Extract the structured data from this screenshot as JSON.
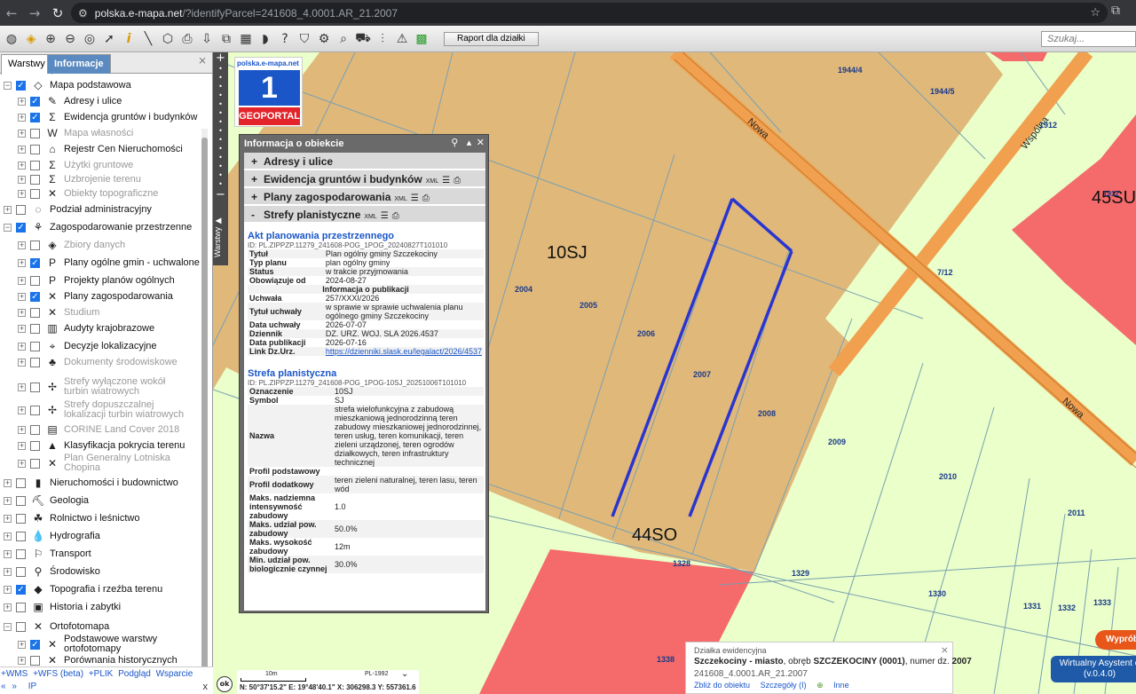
{
  "browser": {
    "url_host": "polska.e-mapa.net",
    "url_query": "/?identifyParcel=241608_4.0001.AR_21.2007"
  },
  "toolbar": {
    "icons": [
      "globe-icon",
      "layers-icon",
      "zoom-in-icon",
      "zoom-out-icon",
      "full-extent-icon",
      "pointer-icon",
      "info-icon",
      "measure-line-icon",
      "measure-area-icon",
      "print-icon",
      "download-icon",
      "share-icon",
      "grid-icon",
      "comment-icon",
      "help-icon",
      "shield-icon",
      "tools-icon",
      "search-icon",
      "cart-icon",
      "filter-icon",
      "warning-icon",
      "color-icon"
    ],
    "raport_label": "Raport dla działki",
    "search_placeholder": "Szukaj..."
  },
  "left_panel": {
    "tabs": [
      "Warstwy",
      "Informacje"
    ],
    "layers": [
      {
        "name": "Mapa podstawowa",
        "checked": true,
        "level": 0,
        "expander": "−",
        "dim": false
      },
      {
        "name": "Adresy i ulice",
        "checked": true,
        "level": 1,
        "expander": "+",
        "dim": false
      },
      {
        "name": "Ewidencja gruntów i budynków",
        "checked": true,
        "level": 1,
        "expander": "+",
        "dim": false
      },
      {
        "name": "Mapa własności",
        "checked": false,
        "level": 1,
        "expander": "+",
        "dim": true
      },
      {
        "name": "Rejestr Cen Nieruchomości",
        "checked": false,
        "level": 1,
        "expander": "+",
        "dim": false
      },
      {
        "name": "Użytki gruntowe",
        "checked": false,
        "level": 1,
        "expander": "+",
        "dim": true
      },
      {
        "name": "Uzbrojenie terenu",
        "checked": false,
        "level": 1,
        "expander": "+",
        "dim": true
      },
      {
        "name": "Obiekty topograficzne",
        "checked": false,
        "level": 1,
        "expander": "+",
        "dim": true
      },
      {
        "name": "Podział administracyjny",
        "checked": false,
        "level": 0,
        "expander": "+",
        "dim": false
      },
      {
        "name": "Zagospodarowanie przestrzenne",
        "checked": true,
        "level": 0,
        "expander": "−",
        "dim": false
      },
      {
        "name": "Zbiory danych",
        "checked": false,
        "level": 1,
        "expander": "+",
        "dim": true
      },
      {
        "name": "Plany ogólne gmin - uchwalone",
        "checked": true,
        "level": 1,
        "expander": "+",
        "dim": false
      },
      {
        "name": "Projekty planów ogólnych",
        "checked": false,
        "level": 1,
        "expander": "+",
        "dim": false
      },
      {
        "name": "Plany zagospodarowania",
        "checked": true,
        "level": 1,
        "expander": "+",
        "dim": false
      },
      {
        "name": "Studium",
        "checked": false,
        "level": 1,
        "expander": "+",
        "dim": true
      },
      {
        "name": "Audyty krajobrazowe",
        "checked": false,
        "level": 1,
        "expander": "+",
        "dim": false
      },
      {
        "name": "Decyzje lokalizacyjne",
        "checked": false,
        "level": 1,
        "expander": "+",
        "dim": false
      },
      {
        "name": "Dokumenty środowiskowe",
        "checked": false,
        "level": 1,
        "expander": "+",
        "dim": true
      },
      {
        "name": "Strefy wyłączone wokół turbin wiatrowych",
        "checked": false,
        "level": 1,
        "expander": "+",
        "dim": true
      },
      {
        "name": "Strefy dopuszczalnej lokalizacji turbin wiatrowych",
        "checked": false,
        "level": 1,
        "expander": "+",
        "dim": true
      },
      {
        "name": "CORINE Land Cover 2018",
        "checked": false,
        "level": 1,
        "expander": "+",
        "dim": true
      },
      {
        "name": "Klasyfikacja pokrycia terenu",
        "checked": false,
        "level": 1,
        "expander": "+",
        "dim": false
      },
      {
        "name": "Plan Generalny Lotniska Chopina",
        "checked": false,
        "level": 1,
        "expander": "+",
        "dim": true
      },
      {
        "name": "Nieruchomości i budownictwo",
        "checked": false,
        "level": 0,
        "expander": "+",
        "dim": false
      },
      {
        "name": "Geologia",
        "checked": false,
        "level": 0,
        "expander": "+",
        "dim": false
      },
      {
        "name": "Rolnictwo i leśnictwo",
        "checked": false,
        "level": 0,
        "expander": "+",
        "dim": false
      },
      {
        "name": "Hydrografia",
        "checked": false,
        "level": 0,
        "expander": "+",
        "dim": false
      },
      {
        "name": "Transport",
        "checked": false,
        "level": 0,
        "expander": "+",
        "dim": false
      },
      {
        "name": "Środowisko",
        "checked": false,
        "level": 0,
        "expander": "+",
        "dim": false
      },
      {
        "name": "Topografia i rzeźba terenu",
        "checked": true,
        "level": 0,
        "expander": "+",
        "dim": false
      },
      {
        "name": "Historia i zabytki",
        "checked": false,
        "level": 0,
        "expander": "+",
        "dim": false
      },
      {
        "name": "Ortofotomapa",
        "checked": false,
        "level": 0,
        "expander": "−",
        "dim": false
      },
      {
        "name": "Podstawowe warstwy ortofotomapy",
        "checked": true,
        "level": 1,
        "expander": "+",
        "dim": false
      },
      {
        "name": "Porównania historycznych",
        "checked": false,
        "level": 1,
        "expander": "+",
        "dim": false
      }
    ],
    "footer_links": [
      "+WMS",
      "+WFS (beta)",
      "+PLIK",
      "Podgląd",
      "Wsparcie"
    ],
    "footer_row2": [
      "«",
      "»",
      "IP"
    ],
    "vertical_tab": "Warstwy"
  },
  "logo": {
    "site": "polska.e-mapa.net",
    "number": "1",
    "label": "GEOPORTAL"
  },
  "info_popup": {
    "title": "Informacja o obiekcie",
    "sections": [
      {
        "sign": "+",
        "label": "Adresy i ulice",
        "tools": false
      },
      {
        "sign": "+",
        "label": "Ewidencja gruntów i budynków",
        "tools": true
      },
      {
        "sign": "+",
        "label": "Plany zagospodarowania",
        "tools": true
      },
      {
        "sign": "-",
        "label": "Strefy planistyczne",
        "tools": true
      }
    ],
    "xml_label": "XML",
    "act": {
      "heading": "Akt planowania przestrzennego",
      "id": "ID: PL.ZIPPZP.11279_241608-POG_1POG_20240827T101010",
      "rows": [
        [
          "Tytuł",
          "Plan ogólny gminy Szczekociny"
        ],
        [
          "Typ planu",
          "plan ogólny gminy"
        ],
        [
          "Status",
          "w trakcie przyjmowania"
        ],
        [
          "Obowiązuje od",
          "2024-08-27"
        ]
      ],
      "pub_header": "Informacja o publikacji",
      "pub_rows": [
        [
          "Uchwała",
          "257/XXXI/2026"
        ],
        [
          "Tytuł uchwały",
          "w sprawie w sprawie uchwalenia planu ogólnego gminy Szczekociny"
        ],
        [
          "Data uchwały",
          "2026-07-07"
        ],
        [
          "Dziennik",
          "DZ. URZ. WOJ. SLA 2026.4537"
        ],
        [
          "Data publikacji",
          "2026-07-16"
        ]
      ],
      "link_key": "Link Dz.Urz.",
      "link_value": "https://dzienniki.slask.eu/legalact/2026/4537"
    },
    "zone": {
      "heading": "Strefa planistyczna",
      "id": "ID: PL.ZIPPZP.11279_241608-POG_1POG-10SJ_20251006T101010",
      "rows": [
        [
          "Oznaczenie",
          "10SJ"
        ],
        [
          "Symbol",
          "SJ"
        ],
        [
          "Nazwa",
          "strefa wielofunkcyjna z zabudową mieszkaniową jednorodzinną teren zabudowy mieszkaniowej jednorodzinnej, teren usług, teren komunikacji, teren zieleni urządzonej, teren ogrodów działkowych, teren infrastruktury technicznej"
        ],
        [
          "Profil podstawowy",
          ""
        ],
        [
          "Profil dodatkowy",
          "teren zieleni naturalnej, teren lasu, teren wód"
        ],
        [
          "Maks. nadziemna intensywność zabudowy",
          "1.0"
        ],
        [
          "Maks. udział pow. zabudowy",
          "50.0%"
        ],
        [
          "Maks. wysokość zabudowy",
          "12m"
        ],
        [
          "Min. udział pow. biologicznie czynnej",
          "30.0%"
        ]
      ]
    }
  },
  "map": {
    "zone_labels": [
      "10SJ",
      "44SO",
      "45SU"
    ],
    "road_labels": [
      "Nowa",
      "Wspólna",
      "Nowa"
    ],
    "parcels": [
      "2004",
      "2005",
      "2006",
      "2007",
      "2008",
      "2009",
      "2010",
      "2011",
      "1328",
      "1329",
      "1330",
      "1331",
      "1332",
      "1333",
      "1338",
      "1944/4",
      "1944/5",
      "1912",
      "1912",
      "7/12",
      "13"
    ],
    "colors": {
      "background": "#eaffc9",
      "zone_brown": "#e0b87a",
      "zone_red": "#f56a6a",
      "road": "#f0a04e",
      "highlight": "#2a35d0"
    }
  },
  "parcel_bar": {
    "header": "Działka ewidencyjna",
    "town": "Szczekociny - miasto",
    "text_mid": ", obręb ",
    "obreb": "SZCZEKOCINY (0001)",
    "text_num": ", numer dz. ",
    "number": "2007",
    "id": "241608_4.0001.AR_21.2007",
    "links": [
      "Zbliż do obiektu",
      "Szczegóły (I)",
      "⊕",
      "Inne"
    ]
  },
  "status": {
    "scale_label": "10m",
    "projection": "PL-1992",
    "coords": "N: 50°37'15.2\"  E: 19°48'40.1\"  X: 306298.3  Y: 557361.6",
    "ok": "ok"
  },
  "right_buttons": {
    "wyprobuj": "Wypróbuj",
    "asystent_line1": "Wirtualny Asystent e",
    "asystent_line2": "(v.0.4.0)"
  }
}
